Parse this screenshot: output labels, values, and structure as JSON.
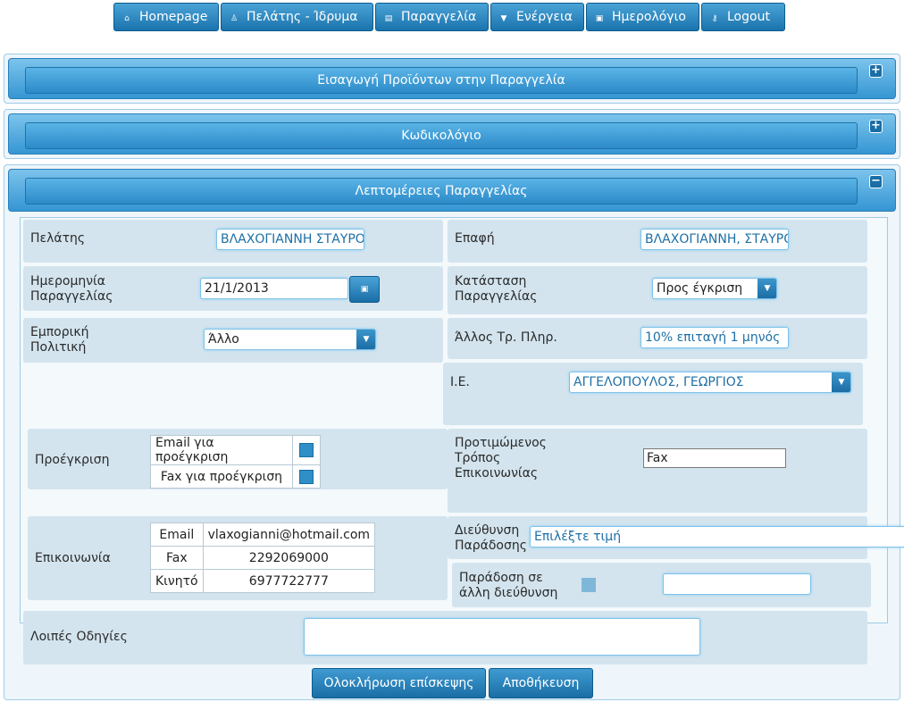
{
  "nav": [
    {
      "label": "Homepage",
      "icon": "home-icon",
      "glyph": "⌂"
    },
    {
      "label": "Πελάτης - Ίδρυμα",
      "icon": "user-icon",
      "glyph": "♙"
    },
    {
      "label": "Παραγγελία",
      "icon": "list-icon",
      "glyph": "▤"
    },
    {
      "label": "Ενέργεια",
      "icon": "caret-down-icon",
      "glyph": "▼"
    },
    {
      "label": "Ημερολόγιο",
      "icon": "calendar-icon",
      "glyph": "▣"
    },
    {
      "label": "Logout",
      "icon": "key-icon",
      "glyph": "⚷"
    }
  ],
  "panels": {
    "insert_products": "Εισαγωγή Προϊόντων στην Παραγγελία",
    "catalog": "Κωδικολόγιο",
    "order_details": "Λεπτομέρειες Παραγγελίας",
    "expand_glyph": "+",
    "collapse_glyph": "−"
  },
  "form": {
    "customer_label": "Πελάτης",
    "customer_value": "ΒΛΑΧΟΓΙΑΝΝΗ ΣΤΑΥΡΟΥΛΑ",
    "contact_label": "Επαφή",
    "contact_value": "ΒΛΑΧΟΓΙΑΝΝΗ, ΣΤΑΥΡΟΥΛΑ",
    "order_date_label_1": "Ημερομηνία",
    "order_date_label_2": "Παραγγελίας",
    "order_date_value": "21/1/2013",
    "order_status_label_1": "Κατάσταση",
    "order_status_label_2": "Παραγγελίας",
    "order_status_value": "Προς έγκριση",
    "commercial_policy_label_1": "Εμπορική",
    "commercial_policy_label_2": "Πολιτική",
    "commercial_policy_value": "Άλλο",
    "other_payment_label": "Άλλος Τρ. Πληρ.",
    "other_payment_value": "10% επιταγή 1 μηνός",
    "ie_label": "Ι.Ε.",
    "ie_value": "ΑΓΓΕΛΟΠΟΥΛΟΣ, ΓΕΩΡΓΙΟΣ",
    "preapproval_label": "Προέγκριση",
    "preapproval_email": "Email για προέγκριση",
    "preapproval_fax": "Fax για προέγκριση",
    "pref_contact_label_1": "Προτιμώμενος",
    "pref_contact_label_2": "Τρόπος",
    "pref_contact_label_3": "Επικοινωνίας",
    "pref_contact_value": "Fax",
    "communication_label": "Επικοινωνία",
    "communication_rows": [
      {
        "type": "Email",
        "value": "vlaxogianni@hotmail.com"
      },
      {
        "type": "Fax",
        "value": "2292069000"
      },
      {
        "type": "Κινητό",
        "value": "6977722777"
      }
    ],
    "delivery_address_label_1": "Διεύθυνση",
    "delivery_address_label_2": "Παράδοσης",
    "delivery_address_placeholder": "Επιλέξτε τιμή",
    "other_address_label_1": "Παράδοση σε",
    "other_address_label_2": "άλλη διεύθυνση",
    "other_address_value": "",
    "other_instructions_label": "Λοιπές Οδηγίες",
    "other_instructions_value": ""
  },
  "actions": {
    "complete_visit": "Ολοκλήρωση επίσκεψης",
    "save": "Αποθήκευση"
  },
  "colors": {
    "accent": "#1a73ad",
    "row_bg": "#d3e4ee"
  }
}
